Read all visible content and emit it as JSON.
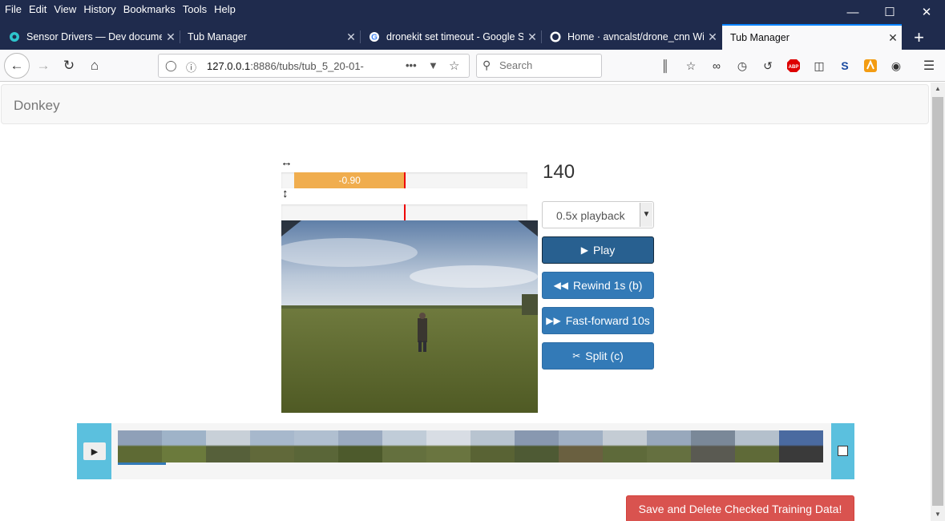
{
  "menu": [
    "File",
    "Edit",
    "View",
    "History",
    "Bookmarks",
    "Tools",
    "Help"
  ],
  "window_controls": [
    "minimize-icon",
    "maximize-icon",
    "close-icon"
  ],
  "tabs": [
    {
      "title": "Sensor Drivers — Dev documen",
      "icon": "docs-icon",
      "active": false
    },
    {
      "title": "Tub Manager",
      "icon": "",
      "active": false
    },
    {
      "title": "dronekit set timeout - Google S",
      "icon": "google-icon",
      "active": false
    },
    {
      "title": "Home · avncalst/drone_cnn Wi",
      "icon": "github-icon",
      "active": false
    },
    {
      "title": "Tub Manager",
      "icon": "",
      "active": true
    }
  ],
  "url": {
    "host": "127.0.0.1",
    "rest": ":8886/tubs/tub_5_20-01-"
  },
  "search": {
    "placeholder": "Search"
  },
  "toolbar_icons": [
    "library-icon",
    "pocket-icon",
    "mask-icon",
    "history-icon",
    "restore-icon",
    "adblock-icon",
    "reader-icon",
    "s-icon",
    "fox-icon",
    "account-icon",
    "hamburger-icon"
  ],
  "brand": "Donkey",
  "controls": {
    "steering_label_icon": "left-right-arrow-icon",
    "throttle_label_icon": "up-down-arrow-icon",
    "steering_value": "-0.90",
    "steering_fraction": -0.9,
    "throttle_value": "",
    "throttle_fraction": 0.0
  },
  "frame_number": "140",
  "playback": {
    "selected": "0.5x playback"
  },
  "buttons": {
    "play": "Play",
    "rewind": "Rewind 1s (b)",
    "fastforward": "Fast-forward 10s",
    "split": "Split (c)"
  },
  "timeline": {
    "progress_fraction": 0.068,
    "thumbnail_count": 16
  },
  "save_delete": "Save and Delete Checked Training Data!",
  "colors": {
    "primary": "#337ab7",
    "info": "#5bc0de",
    "warning": "#f0ad4e",
    "danger": "#d9534f",
    "browser_dark": "#1f2b4d"
  }
}
